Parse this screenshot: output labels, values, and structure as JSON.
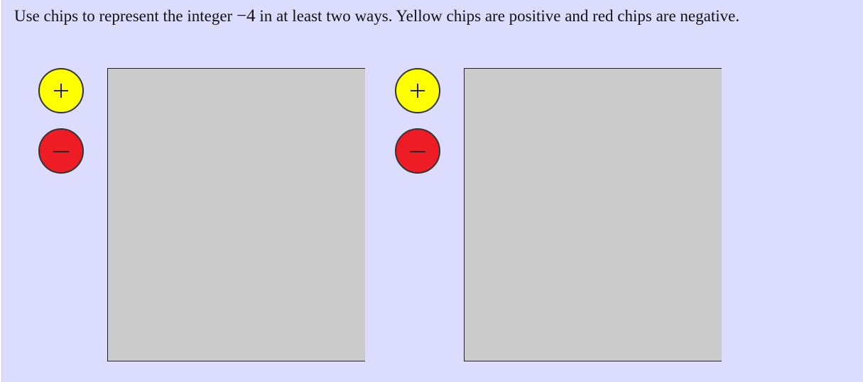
{
  "prompt": {
    "text_before": "Use chips to represent the integer ",
    "number": "−4",
    "text_after": " in at least two ways. Yellow chips are positive and red chips are negative."
  },
  "chips": {
    "positive": {
      "icon": "plus-icon",
      "color": "#ffff00"
    },
    "negative": {
      "icon": "minus-icon",
      "color": "#ee1c25"
    }
  },
  "workspaces": [
    {
      "id": "workspace-1",
      "background": "#cbcbcb"
    },
    {
      "id": "workspace-2",
      "background": "#cbcbcb"
    }
  ]
}
